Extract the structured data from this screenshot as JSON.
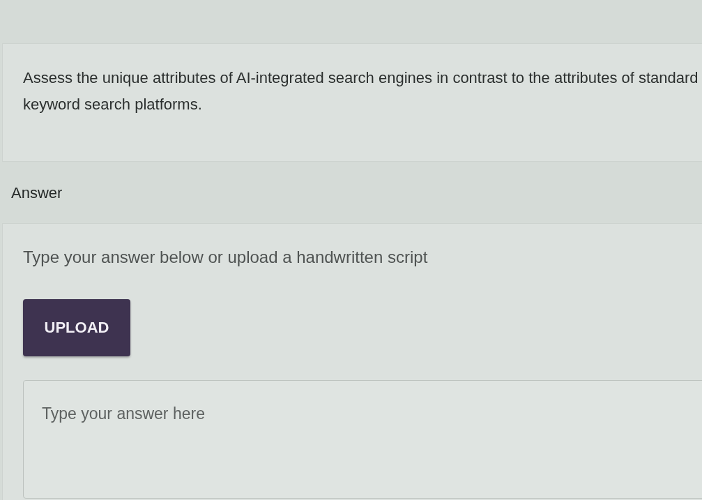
{
  "question": {
    "text": "Assess the unique attributes of AI-integrated search engines in contrast to the attributes of standard keyword search platforms."
  },
  "answer_section": {
    "heading": "Answer",
    "instruction": "Type your answer below or upload a handwritten script",
    "upload_button": "UPLOAD",
    "answer_field": {
      "placeholder": "Type your answer here"
    }
  }
}
